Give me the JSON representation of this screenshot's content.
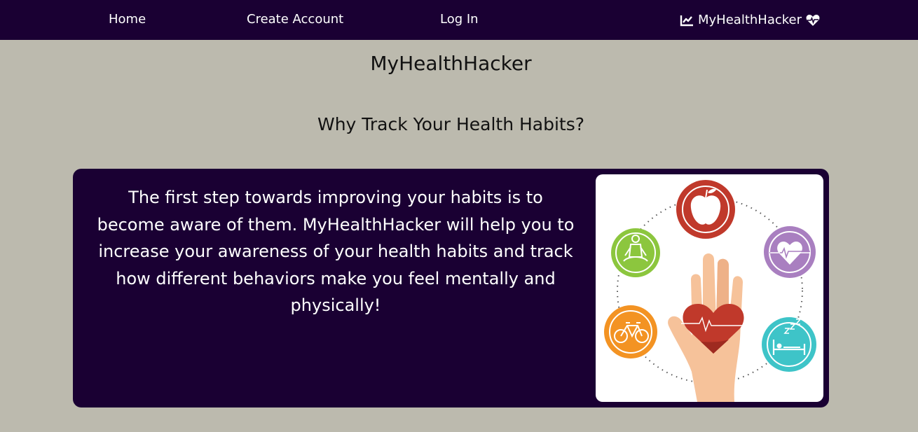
{
  "nav": {
    "home": "Home",
    "create_account": "Create Account",
    "log_in": "Log In",
    "brand": "MyHealthHacker",
    "brand_left_icon": "chart-line-icon",
    "brand_right_icon": "heartbeat-icon"
  },
  "main": {
    "title": "MyHealthHacker",
    "section_title": "Why Track Your Health Habits?",
    "card_text": "The first step towards improving your habits is to become aware of them. MyHealthHacker will help you to increase your awareness of your health habits and track how different behaviors make you feel mentally and physically!"
  },
  "colors": {
    "nav_bg": "#1a0033",
    "page_bg": "#bcbaae",
    "card_bg": "#1a0033",
    "apple_red": "#c0392b",
    "yoga_green": "#8cc63e",
    "heart_purple": "#a97fc0",
    "bike_orange": "#f39323",
    "sleep_teal": "#3ec4c8"
  }
}
